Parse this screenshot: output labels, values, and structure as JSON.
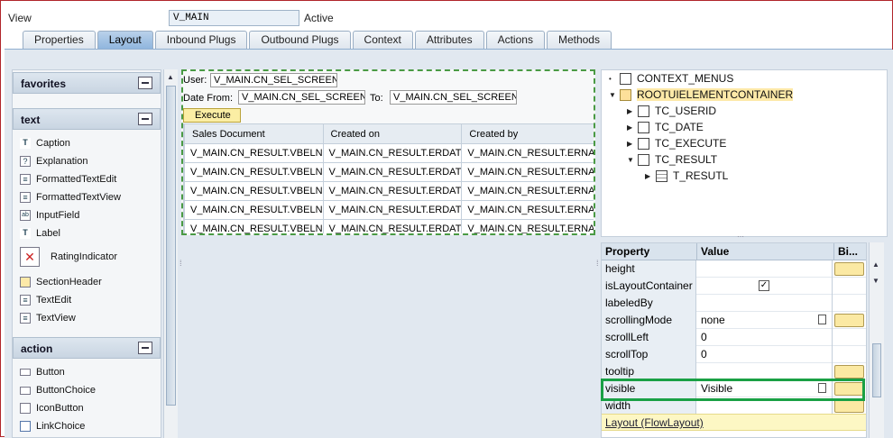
{
  "header": {
    "view_label": "View",
    "view_name": "V_MAIN",
    "status": "Active"
  },
  "tabs": [
    "Properties",
    "Layout",
    "Inbound Plugs",
    "Outbound Plugs",
    "Context",
    "Attributes",
    "Actions",
    "Methods"
  ],
  "palette": {
    "sections": [
      {
        "title": "favorites",
        "items": []
      },
      {
        "title": "text",
        "items": [
          "Caption",
          "Explanation",
          "FormattedTextEdit",
          "FormattedTextView",
          "InputField",
          "Label",
          "RatingIndicator",
          "SectionHeader",
          "TextEdit",
          "TextView"
        ]
      },
      {
        "title": "action",
        "items": [
          "Button",
          "ButtonChoice",
          "IconButton",
          "LinkChoice"
        ]
      }
    ]
  },
  "canvas": {
    "user_label": "User:",
    "user_value": "V_MAIN.CN_SEL_SCREEN",
    "date_from_label": "Date From:",
    "date_from_value": "V_MAIN.CN_SEL_SCREEN",
    "to_label": "To:",
    "to_value": "V_MAIN.CN_SEL_SCREEN",
    "execute_label": "Execute",
    "columns": [
      "Sales Document",
      "Created on",
      "Created by"
    ],
    "rows": [
      [
        "V_MAIN.CN_RESULT.VBELN",
        "V_MAIN.CN_RESULT.ERDAT",
        "V_MAIN.CN_RESULT.ERNA"
      ],
      [
        "V_MAIN.CN_RESULT.VBELN",
        "V_MAIN.CN_RESULT.ERDAT",
        "V_MAIN.CN_RESULT.ERNA"
      ],
      [
        "V_MAIN.CN_RESULT.VBELN",
        "V_MAIN.CN_RESULT.ERDAT",
        "V_MAIN.CN_RESULT.ERNA"
      ],
      [
        "V_MAIN.CN_RESULT.VBELN",
        "V_MAIN.CN_RESULT.ERDAT",
        "V_MAIN.CN_RESULT.ERNA"
      ],
      [
        "V_MAIN.CN_RESULT.VBELN",
        "V_MAIN.CN_RESULT.ERDAT",
        "V_MAIN.CN_RESULT.ERNA"
      ]
    ]
  },
  "tree": [
    {
      "label": "CONTEXT_MENUS",
      "arrow": "•",
      "depth": 0
    },
    {
      "label": "ROOTUIELEMENTCONTAINER",
      "arrow": "▼",
      "depth": 0,
      "highlight": true
    },
    {
      "label": "TC_USERID",
      "arrow": "▶",
      "depth": 1
    },
    {
      "label": "TC_DATE",
      "arrow": "▶",
      "depth": 1
    },
    {
      "label": "TC_EXECUTE",
      "arrow": "▶",
      "depth": 1
    },
    {
      "label": "TC_RESULT",
      "arrow": "▼",
      "depth": 1
    },
    {
      "label": "T_RESUTL",
      "arrow": "▶",
      "depth": 2,
      "table": true
    }
  ],
  "properties": {
    "headers": [
      "Property",
      "Value",
      "Bi..."
    ],
    "rows": [
      {
        "name": "height",
        "value": "",
        "bind": true
      },
      {
        "name": "isLayoutContainer",
        "value": "✓",
        "bind": false
      },
      {
        "name": "labeledBy",
        "value": "",
        "bind": false
      },
      {
        "name": "scrollingMode",
        "value": "none",
        "bind": true,
        "help": true
      },
      {
        "name": "scrollLeft",
        "value": "0",
        "bind": false
      },
      {
        "name": "scrollTop",
        "value": "0",
        "bind": false
      },
      {
        "name": "tooltip",
        "value": "",
        "bind": true
      },
      {
        "name": "visible",
        "value": "Visible",
        "bind": true,
        "help": true
      },
      {
        "name": "width",
        "value": "",
        "bind": true
      }
    ],
    "group_label": "Layout (FlowLayout)"
  }
}
